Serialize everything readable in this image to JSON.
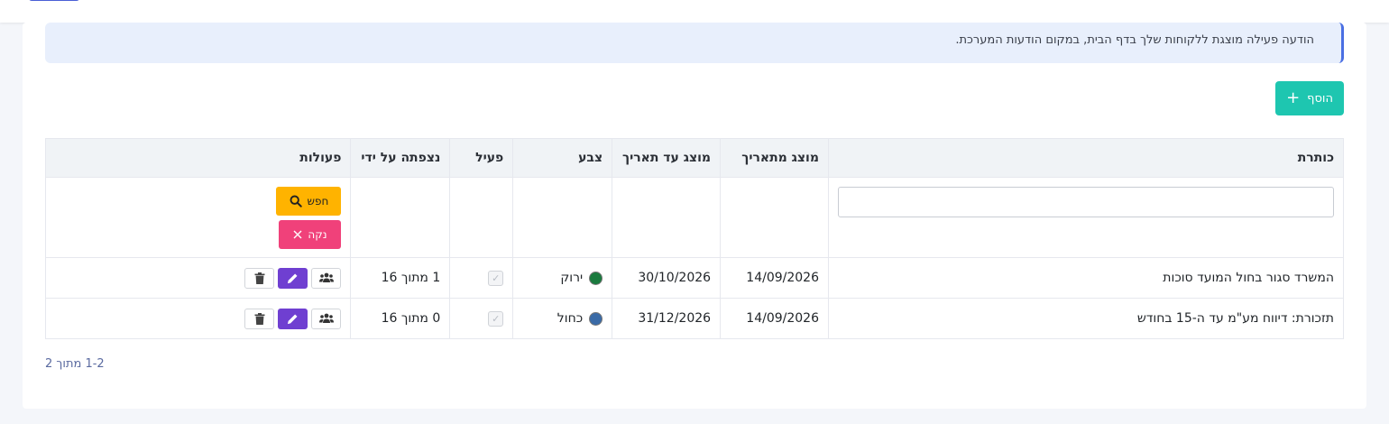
{
  "alert": {
    "text": "הודעה פעילה מוצגת ללקוחות שלך בדף הבית, במקום הודעות המערכת."
  },
  "toolbar": {
    "add_label": "הוסף",
    "add_icon": "plus-icon"
  },
  "table": {
    "headers": {
      "title": "כותרת",
      "from_date": "מוצג מתאריך",
      "to_date": "מוצג עד תאריך",
      "color": "צבע",
      "active": "פעיל",
      "viewed_by": "נצפתה על ידי",
      "actions": "פעולות"
    },
    "filter": {
      "title_value": "",
      "search_label": "חפש",
      "clear_label": "נקה"
    },
    "rows": [
      {
        "title": "המשרד סגור בחול המועד סוכות",
        "from_date": "14/09/2026",
        "to_date": "30/10/2026",
        "color_name": "ירוק",
        "color_hex": "#1a7a3e",
        "active": true,
        "viewed_by": "1 מתוך 16"
      },
      {
        "title": "תזכורת: דיווח מע\"מ עד ה-15 בחודש",
        "from_date": "14/09/2026",
        "to_date": "31/12/2026",
        "color_name": "כחול",
        "color_hex": "#3a6aa6",
        "active": true,
        "viewed_by": "0 מתוך 16"
      }
    ]
  },
  "pagination": {
    "text": "1-2 מתוך 2"
  },
  "colors": {
    "accent_teal": "#1ec6b0",
    "search_yellow": "#ffb300",
    "clear_pink": "#f0417a",
    "edit_purple": "#6f3fd1",
    "alert_bg": "#e8effc"
  }
}
